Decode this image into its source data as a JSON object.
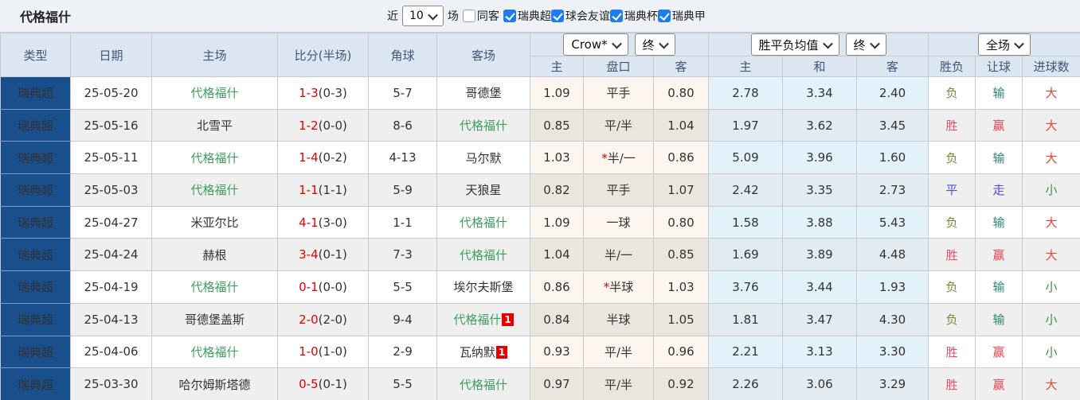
{
  "header_bar": {
    "title": "代格福什",
    "recent_label": "近",
    "recent_select_value": "10",
    "matches_label": "场",
    "same_opponent": {
      "label": "同客",
      "checked": false
    },
    "league_filters": [
      {
        "label": "瑞典超",
        "checked": true
      },
      {
        "label": "球会友谊",
        "checked": true
      },
      {
        "label": "瑞典杯",
        "checked": true
      },
      {
        "label": "瑞典甲",
        "checked": true
      }
    ]
  },
  "table": {
    "columns": [
      "类型",
      "日期",
      "主场",
      "比分(半场)",
      "角球",
      "客场"
    ],
    "odds_group": {
      "company_select": "Crow*",
      "time_select": "终"
    },
    "avg_group": {
      "type_select": "胜平负均值",
      "time_select": "终"
    },
    "scope_select": "全场",
    "sub_headers": [
      "主",
      "盘口",
      "客",
      "主",
      "和",
      "客",
      "胜负",
      "让球",
      "进球数"
    ],
    "rows": [
      {
        "league": "瑞典超",
        "date": "25-05-20",
        "home": "代格福什",
        "home_is_self": true,
        "home_badge": "",
        "score": "1-3",
        "half": "(0-3)",
        "corners": "5-7",
        "away": "哥德堡",
        "away_is_self": false,
        "away_badge": "",
        "odds_home": "1.09",
        "handicap": "平手",
        "handicap_star": false,
        "odds_away": "0.80",
        "avg_home": "2.78",
        "avg_draw": "3.34",
        "avg_away": "2.40",
        "wdl": "负",
        "handicap_result": "输",
        "goals_result": "大"
      },
      {
        "league": "瑞典超",
        "date": "25-05-16",
        "home": "北雪平",
        "home_is_self": false,
        "home_badge": "",
        "score": "1-2",
        "half": "(0-0)",
        "corners": "8-6",
        "away": "代格福什",
        "away_is_self": true,
        "away_badge": "",
        "odds_home": "0.85",
        "handicap": "平/半",
        "handicap_star": false,
        "odds_away": "1.04",
        "avg_home": "1.97",
        "avg_draw": "3.62",
        "avg_away": "3.45",
        "wdl": "胜",
        "handicap_result": "赢",
        "goals_result": "大"
      },
      {
        "league": "瑞典超",
        "date": "25-05-11",
        "home": "代格福什",
        "home_is_self": true,
        "home_badge": "",
        "score": "1-4",
        "half": "(0-2)",
        "corners": "4-13",
        "away": "马尔默",
        "away_is_self": false,
        "away_badge": "",
        "odds_home": "1.03",
        "handicap": "半/一",
        "handicap_star": true,
        "odds_away": "0.86",
        "avg_home": "5.09",
        "avg_draw": "3.96",
        "avg_away": "1.60",
        "wdl": "负",
        "handicap_result": "输",
        "goals_result": "大"
      },
      {
        "league": "瑞典超",
        "date": "25-05-03",
        "home": "代格福什",
        "home_is_self": true,
        "home_badge": "",
        "score": "1-1",
        "half": "(1-1)",
        "corners": "5-9",
        "away": "天狼星",
        "away_is_self": false,
        "away_badge": "",
        "odds_home": "0.82",
        "handicap": "平手",
        "handicap_star": false,
        "odds_away": "1.07",
        "avg_home": "2.42",
        "avg_draw": "3.35",
        "avg_away": "2.73",
        "wdl": "平",
        "handicap_result": "走",
        "goals_result": "小"
      },
      {
        "league": "瑞典超",
        "date": "25-04-27",
        "home": "米亚尔比",
        "home_is_self": false,
        "home_badge": "",
        "score": "4-1",
        "half": "(3-0)",
        "corners": "1-1",
        "away": "代格福什",
        "away_is_self": true,
        "away_badge": "",
        "odds_home": "1.09",
        "handicap": "一球",
        "handicap_star": false,
        "odds_away": "0.80",
        "avg_home": "1.58",
        "avg_draw": "3.88",
        "avg_away": "5.43",
        "wdl": "负",
        "handicap_result": "输",
        "goals_result": "大"
      },
      {
        "league": "瑞典超",
        "date": "25-04-24",
        "home": "赫根",
        "home_is_self": false,
        "home_badge": "",
        "score": "3-4",
        "half": "(0-1)",
        "corners": "7-3",
        "away": "代格福什",
        "away_is_self": true,
        "away_badge": "",
        "odds_home": "1.04",
        "handicap": "半/一",
        "handicap_star": false,
        "odds_away": "0.85",
        "avg_home": "1.69",
        "avg_draw": "3.89",
        "avg_away": "4.48",
        "wdl": "胜",
        "handicap_result": "赢",
        "goals_result": "大"
      },
      {
        "league": "瑞典超",
        "date": "25-04-19",
        "home": "代格福什",
        "home_is_self": true,
        "home_badge": "",
        "score": "0-1",
        "half": "(0-0)",
        "corners": "5-5",
        "away": "埃尔夫斯堡",
        "away_is_self": false,
        "away_badge": "",
        "odds_home": "0.86",
        "handicap": "半球",
        "handicap_star": true,
        "odds_away": "1.03",
        "avg_home": "3.76",
        "avg_draw": "3.44",
        "avg_away": "1.93",
        "wdl": "负",
        "handicap_result": "输",
        "goals_result": "小"
      },
      {
        "league": "瑞典超",
        "date": "25-04-13",
        "home": "哥德堡盖斯",
        "home_is_self": false,
        "home_badge": "",
        "score": "2-0",
        "half": "(2-0)",
        "corners": "9-4",
        "away": "代格福什",
        "away_is_self": true,
        "away_badge": "1",
        "odds_home": "0.84",
        "handicap": "半球",
        "handicap_star": false,
        "odds_away": "1.05",
        "avg_home": "1.81",
        "avg_draw": "3.47",
        "avg_away": "4.30",
        "wdl": "负",
        "handicap_result": "输",
        "goals_result": "小"
      },
      {
        "league": "瑞典超",
        "date": "25-04-06",
        "home": "代格福什",
        "home_is_self": true,
        "home_badge": "",
        "score": "1-0",
        "half": "(1-0)",
        "corners": "2-9",
        "away": "瓦纳默",
        "away_is_self": false,
        "away_badge": "1",
        "odds_home": "0.93",
        "handicap": "平/半",
        "handicap_star": false,
        "odds_away": "0.96",
        "avg_home": "2.21",
        "avg_draw": "3.13",
        "avg_away": "3.30",
        "wdl": "胜",
        "handicap_result": "赢",
        "goals_result": "小"
      },
      {
        "league": "瑞典超",
        "date": "25-03-30",
        "home": "哈尔姆斯塔德",
        "home_is_self": false,
        "home_badge": "",
        "score": "0-5",
        "half": "(0-1)",
        "corners": "5-5",
        "away": "代格福什",
        "away_is_self": true,
        "away_badge": "",
        "odds_home": "0.97",
        "handicap": "平/半",
        "handicap_star": false,
        "odds_away": "0.92",
        "avg_home": "2.26",
        "avg_draw": "3.06",
        "avg_away": "3.29",
        "wdl": "胜",
        "handicap_result": "赢",
        "goals_result": "大"
      }
    ]
  },
  "colors": {
    "accent_navy": "#1a4f8e",
    "self_team_green": "#3f9e5e",
    "score_red": "#e60000",
    "checkbox_blue": "#1f7ce8",
    "header_bg": "#dce6f1",
    "result_map": {
      "胜": "#e3506a",
      "赢": "#e3464f",
      "负": "#6f8c36",
      "输": "#2f8472",
      "平": "#4d4dd8",
      "走": "#4d4dd8",
      "大": "#e3463b",
      "小": "#3e8e4e"
    }
  }
}
